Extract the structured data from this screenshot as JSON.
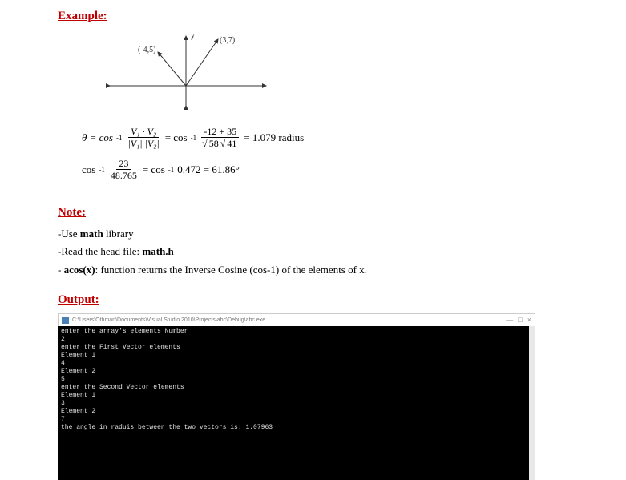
{
  "headings": {
    "example": "Example:",
    "note": "Note:",
    "output": "Output:"
  },
  "diagram": {
    "y_label": "y",
    "point1": "(-4,5)",
    "point2": "(3,7)"
  },
  "formula1": {
    "theta": "θ = cos",
    "sup1": "-1",
    "frac1_num": "V₁ · V₂",
    "frac1_den": "|V₁|  |V₂|",
    "eq": " = cos",
    "sup2": "-1",
    "frac2_num": "-12 + 35",
    "frac2_den_a": "58",
    "frac2_den_b": "41",
    "result": " = 1.079 radius"
  },
  "formula2": {
    "lhs": "cos",
    "sup1": "-1",
    "frac_num": "23",
    "frac_den": "48.765",
    "eq": " = cos",
    "sup2": "-1",
    "rhs": " 0.472 = 61.86°"
  },
  "notes": {
    "line1_prefix": "-Use ",
    "line1_bold": "math",
    "line1_suffix": " library",
    "line2_prefix": "-Read the head file: ",
    "line2_bold": "math.h",
    "line3_prefix": "- ",
    "line3_bold": "acos(x)",
    "line3_suffix": ": function returns the Inverse Cosine (cos-1) of the elements of x."
  },
  "console": {
    "title": "C:\\Users\\Othman\\Documents\\Visual Studio 2010\\Projects\\abc\\Debug\\abc.exe",
    "btn_min": "—",
    "btn_max": "□",
    "btn_close": "×",
    "lines": [
      "enter the array's elements Number",
      "2",
      "enter the First Vector elements",
      "Element 1",
      "4",
      "Element 2",
      "5",
      "enter the Second Vector elements",
      "Element 1",
      "3",
      "Element 2",
      "7",
      "the angle in raduis between the two vectors is: 1.07963"
    ]
  }
}
